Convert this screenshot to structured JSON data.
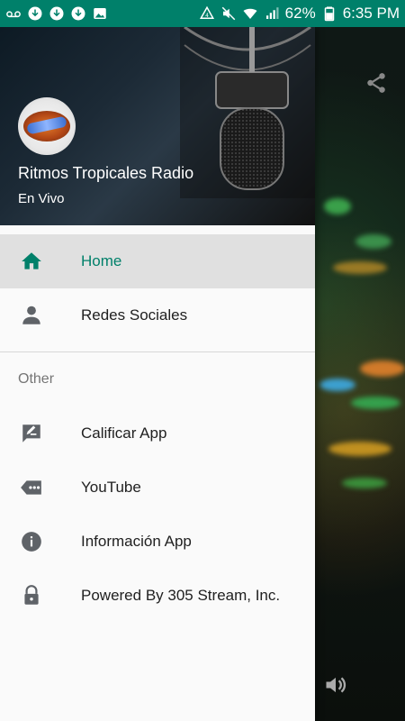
{
  "status_bar": {
    "battery": "62%",
    "time": "6:35 PM",
    "bg_color": "#00806a"
  },
  "drawer": {
    "header": {
      "title": "Ritmos Tropicales Radio",
      "subtitle": "En Vivo"
    },
    "items": [
      {
        "label": "Home",
        "icon": "home-icon",
        "active": true
      },
      {
        "label": "Redes Sociales",
        "icon": "person-icon",
        "active": false
      }
    ],
    "section_label": "Other",
    "other_items": [
      {
        "label": "Calificar App",
        "icon": "rate-icon"
      },
      {
        "label": "YouTube",
        "icon": "tag-dots-icon"
      },
      {
        "label": "Información App",
        "icon": "info-icon"
      },
      {
        "label": "Powered By 305 Stream, Inc.",
        "icon": "lock-icon"
      }
    ],
    "accent_color": "#00806a",
    "icon_color": "#5f6368"
  },
  "background": {
    "icons": [
      "share-icon",
      "volume-icon"
    ]
  }
}
